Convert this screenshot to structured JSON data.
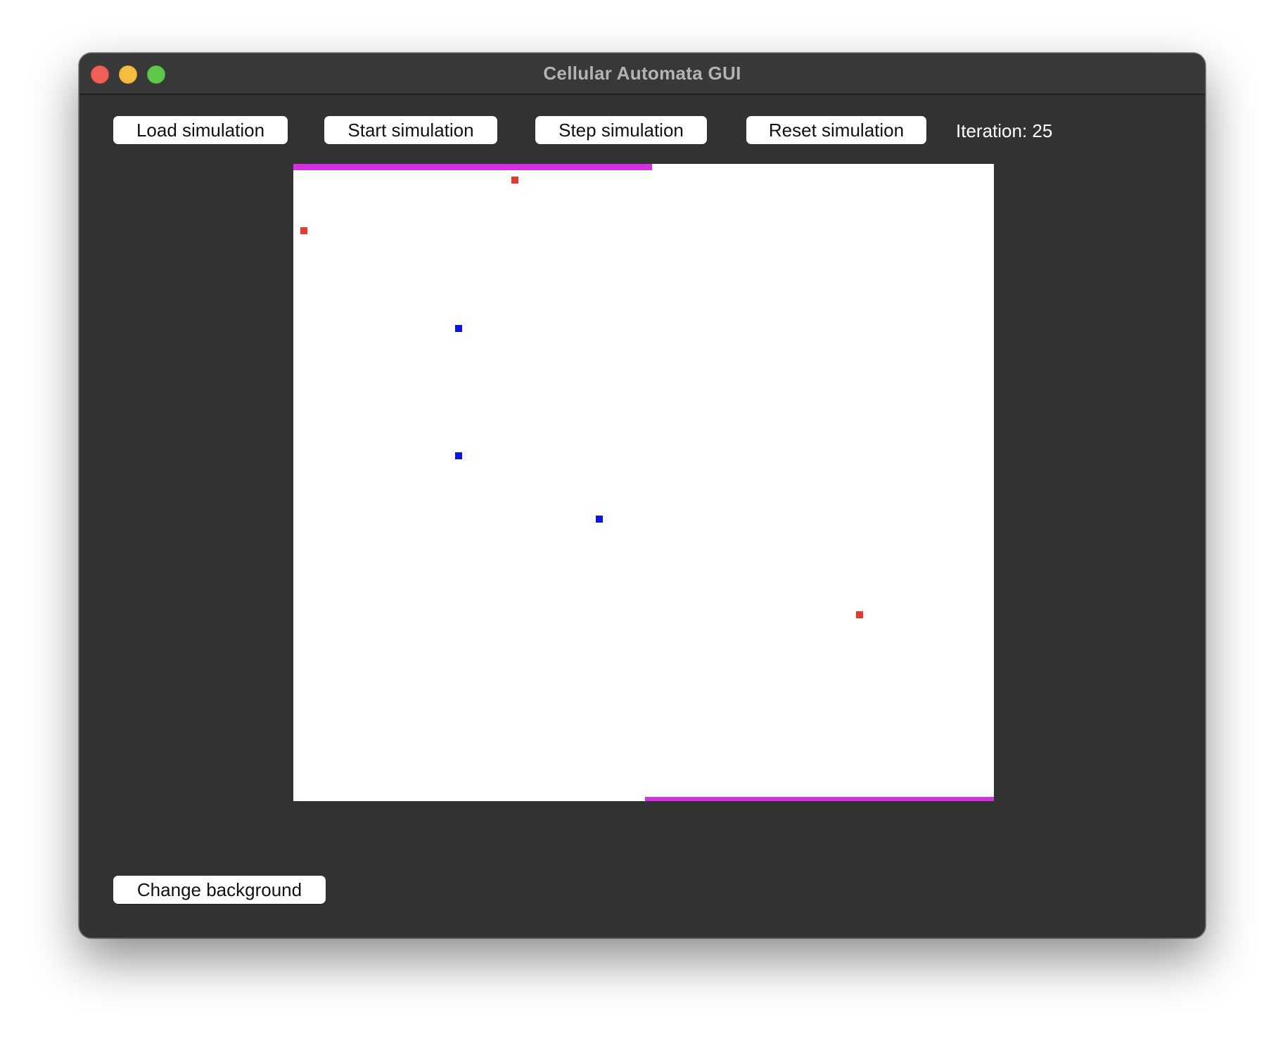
{
  "window": {
    "title": "Cellular Automata GUI"
  },
  "toolbar": {
    "load_label": "Load simulation",
    "start_label": "Start simulation",
    "step_label": "Step simulation",
    "reset_label": "Reset simulation",
    "iteration_text": "Iteration: 25"
  },
  "footer": {
    "change_background_label": "Change background"
  },
  "grid": {
    "background_color": "#ffffff",
    "border_color": "#d52fe0",
    "cell_colors": {
      "red": "#e23b2e",
      "blue": "#0a14e6"
    }
  }
}
